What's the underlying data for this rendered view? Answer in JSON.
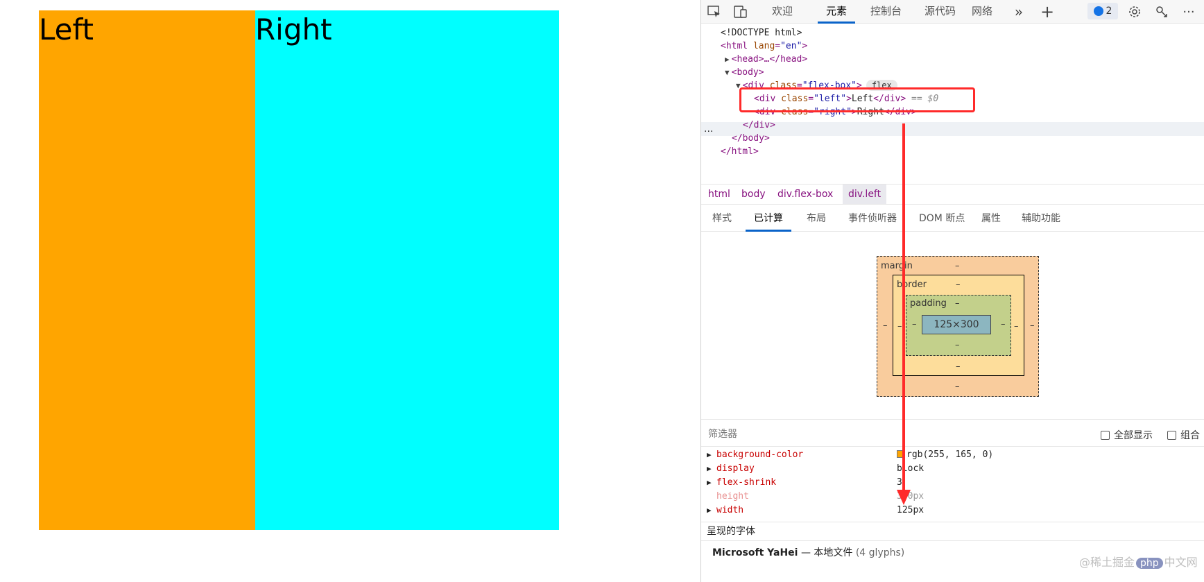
{
  "preview": {
    "left_text": "Left",
    "right_text": "Right",
    "colors": {
      "left": "#ffa500",
      "right": "#00ffff"
    }
  },
  "devtools": {
    "toolbar": {
      "tabs": [
        "欢迎",
        "元素",
        "控制台",
        "源代码",
        "网络"
      ],
      "active_tab": "元素",
      "issues_count": "2",
      "icons": [
        "inspect-icon",
        "device-emulation-icon",
        "more-tabs-icon",
        "add-tab-icon",
        "issues-icon",
        "settings-icon",
        "connect-icon",
        "more-options-icon"
      ]
    },
    "dom": {
      "doctype": "<!DOCTYPE html>",
      "html_open_tag": "<html",
      "html_attr": "lang",
      "html_attr_val": "\"en\"",
      "head": "<head>…</head>",
      "body_open": "<body>",
      "div_open_tag": "<div",
      "div_attr": "class",
      "div_attr_val": "\"flex-box\"",
      "div_end": ">",
      "flex_pill": "flex",
      "left_open_tag": "<div",
      "left_attr": "class",
      "left_attr_val": "\"left\"",
      "left_text": "Left",
      "left_close": "</div>",
      "left_ref": "== $0",
      "right_open_tag": "<div",
      "right_attr": "class",
      "right_attr_val": "\"right\"",
      "right_text": "Right",
      "right_close": "</div>",
      "div_close": "</div>",
      "body_close": "</body>",
      "html_close": "</html>",
      "ellipsis": "..."
    },
    "breadcrumb": [
      "html",
      "body",
      "div.flex-box",
      "div.left"
    ],
    "subtabs": [
      "样式",
      "已计算",
      "布局",
      "事件侦听器",
      "DOM 断点",
      "属性",
      "辅助功能"
    ],
    "active_subtab": "已计算",
    "box_model": {
      "margin_label": "margin",
      "border_label": "border",
      "padding_label": "padding",
      "content_size": "125×300",
      "dash": "–"
    },
    "filter": {
      "placeholder": "筛选器",
      "show_all": "全部显示",
      "group": "组合"
    },
    "computed": [
      {
        "name": "background-color",
        "value": "rgb(255, 165, 0)",
        "expandable": true,
        "swatch": "#ffa500"
      },
      {
        "name": "display",
        "value": "block",
        "expandable": true
      },
      {
        "name": "flex-shrink",
        "value": "3",
        "expandable": true
      },
      {
        "name": "height",
        "value": "300px",
        "expandable": false,
        "inherited": true
      },
      {
        "name": "width",
        "value": "125px",
        "expandable": true
      }
    ],
    "fonts": {
      "header": "呈现的字体",
      "font_name": "Microsoft YaHei",
      "separator": "—",
      "source": "本地文件",
      "glyphs": "(4 glyphs)"
    }
  },
  "watermark": {
    "prefix": "@稀土掘金",
    "logo": "php",
    "suffix": "中文网"
  },
  "annotation_colors": {
    "highlight": "#ff2a2a"
  }
}
